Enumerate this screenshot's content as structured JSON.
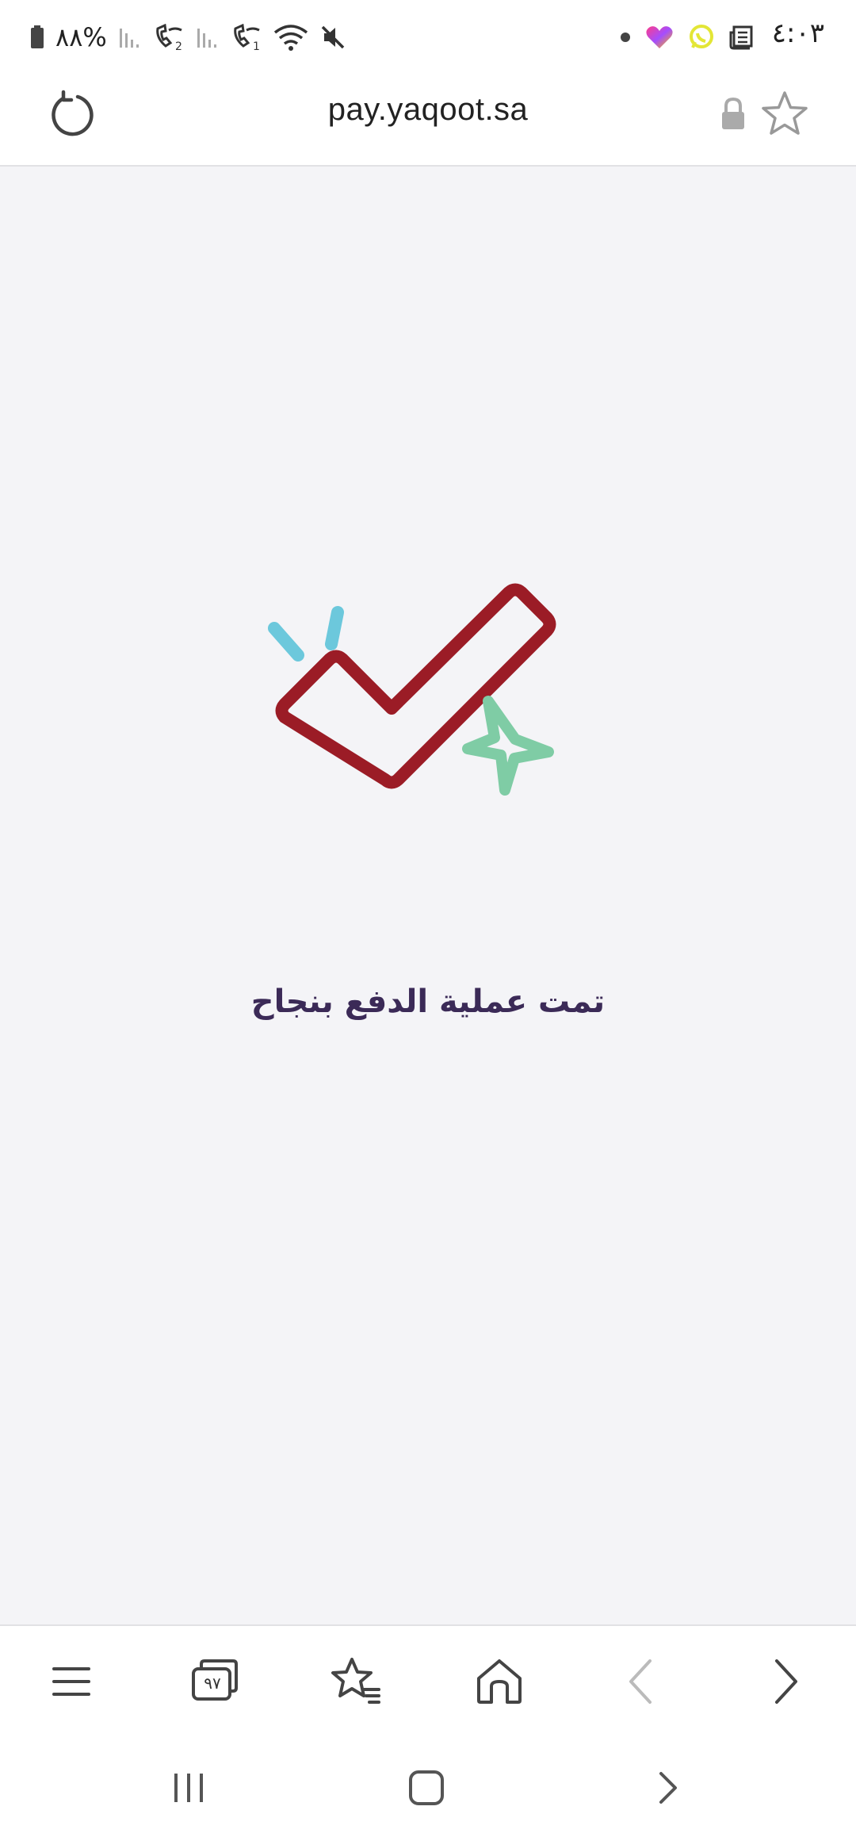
{
  "status_bar": {
    "time": "٤:٠٣",
    "battery": "%٨٨",
    "icons": [
      "mute-icon",
      "wifi-icon",
      "wifi-call-1-icon",
      "signal-1-icon",
      "wifi-call-2-icon",
      "signal-2-icon",
      "battery-icon",
      "dot-icon",
      "heart-app-icon",
      "whatsapp-icon",
      "news-icon"
    ]
  },
  "address_bar": {
    "url": "pay.yaqoot.sa",
    "icons": [
      "reload-icon",
      "lock-icon",
      "star-icon"
    ]
  },
  "main": {
    "message": "تمت عملية الدفع بنجاح",
    "graphic": "checkmark-sparkle-icon",
    "colors": {
      "check": "#9b1c26",
      "sparkle": "#7fcca5",
      "spark_lines": "#6cc8dc",
      "text": "#3b2a57",
      "background": "#f4f4f7"
    }
  },
  "toolbar": {
    "tab_count": "٩٧",
    "icons": [
      "menu-icon",
      "tabs-icon",
      "bookmarks-icon",
      "home-icon",
      "back-icon",
      "forward-icon"
    ]
  },
  "nav_bar": {
    "icons": [
      "recents-icon",
      "home-nav-icon",
      "back-nav-icon"
    ]
  }
}
